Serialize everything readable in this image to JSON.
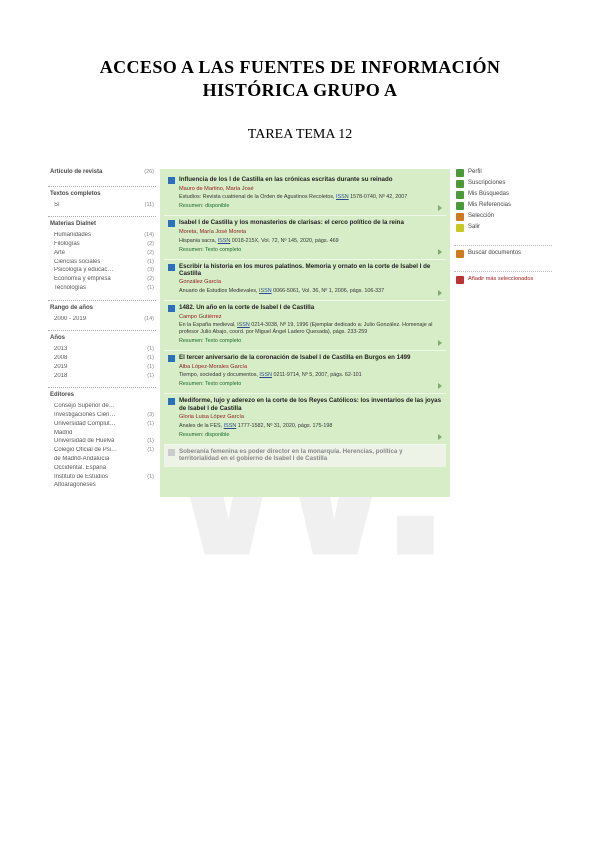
{
  "watermark": "W.",
  "title_line1": "ACCESO A LAS FUENTES DE INFORMACIÓN",
  "title_line2": "HISTÓRICA GRUPO A",
  "subtitle": "TAREA TEMA 12",
  "facets": {
    "block1": {
      "head": "Artículo de revista",
      "count": "(26)"
    },
    "block2": {
      "head": "Textos completos",
      "rows": [
        {
          "lbl": "Sí",
          "cnt": "(11)"
        }
      ]
    },
    "block3": {
      "head": "Materias Dialnet",
      "rows": [
        {
          "lbl": "Humanidades",
          "cnt": "(14)"
        },
        {
          "lbl": "Filologías",
          "cnt": "(2)"
        },
        {
          "lbl": "Arte",
          "cnt": "(2)"
        },
        {
          "lbl": "Ciencias sociales",
          "cnt": "(1)"
        },
        {
          "lbl": "Psicología y educac…",
          "cnt": "(3)"
        },
        {
          "lbl": "Economía y empresa",
          "cnt": "(2)"
        },
        {
          "lbl": "Tecnologías",
          "cnt": "(1)"
        }
      ]
    },
    "block4": {
      "head": "Rango de años",
      "rows": [
        {
          "lbl": "2000 - 2019",
          "cnt": "(14)"
        }
      ]
    },
    "block5": {
      "head": "Años",
      "rows": [
        {
          "lbl": "2013",
          "cnt": "(1)"
        },
        {
          "lbl": "2008",
          "cnt": "(1)"
        },
        {
          "lbl": "2019",
          "cnt": "(1)"
        },
        {
          "lbl": "2018",
          "cnt": "(1)"
        }
      ]
    },
    "block6": {
      "head": "Editores",
      "rows": [
        {
          "lbl": "Consejo Superior de…",
          "cnt": ""
        },
        {
          "lbl": "Investigaciones Cien…",
          "cnt": "(3)"
        },
        {
          "lbl": "Universidad Complut…",
          "cnt": "(1)"
        },
        {
          "lbl": "Madrid",
          "cnt": ""
        },
        {
          "lbl": "Universidad de Huelva",
          "cnt": "(1)"
        },
        {
          "lbl": "Colegio Oficial de Psi…",
          "cnt": "(1)"
        },
        {
          "lbl": "de Madrid-Andalucía",
          "cnt": ""
        },
        {
          "lbl": "Occidental. España",
          "cnt": ""
        },
        {
          "lbl": "Instituto de Estudios",
          "cnt": "(1)"
        },
        {
          "lbl": "Altoaragoneses",
          "cnt": ""
        }
      ]
    }
  },
  "records": [
    {
      "title": "Influencia de los I de Castilla en las crónicas escritas durante su reinado",
      "author": "Mauro de Martino, María José",
      "source_pre": "Estudios: Revista cuatrienal de la Orden de Agustinos Recoletos, ",
      "issn": "ISSN",
      "source_post": " 1578-0740, Nº 42, 2007",
      "summary": "Resumen: disponible"
    },
    {
      "title": "Isabel I de Castilla y los monasterios de clarisas: el cerco político de la reina",
      "author": "Moreta, María José Moreta",
      "source_pre": "Hispania sacra, ",
      "issn": "ISSN",
      "source_post": " 0018-215X, Vol. 72, Nº 145, 2020, págs. 469",
      "summary": "Resumen: Texto completo"
    },
    {
      "title": "Escribir la historia en los muros palatinos. Memoria y ornato en la corte de Isabel I de Castilla",
      "author": "González García",
      "source_pre": "Anuario de Estudios Medievales, ",
      "issn": "ISSN",
      "source_post": " 0066-5061, Vol. 36, Nº 1, 2006, págs. 106-337",
      "summary": ""
    },
    {
      "title": "1482. Un año en la corte de Isabel I de Castilla",
      "author": "Campo Gutiérrez",
      "source_pre": "En la España medieval, ",
      "issn": "ISSN",
      "source_post": " 0214-3038, Nº 19, 1996 (Ejemplar dedicado a: Julio González. Homenaje al profesor Julio Abajo, coord. por Miguel Ángel Ladero Quesada), págs. 233-259",
      "summary": "Resumen: Texto completo"
    },
    {
      "title": "El tercer aniversario de la coronación de Isabel I de Castilla en Burgos en 1499",
      "author": "Alba López-Morales García",
      "source_pre": "Tiempo, sociedad y documentos, ",
      "issn": "ISSN",
      "source_post": " 0211-9714, Nº 5, 2007, págs. 62-101",
      "summary": "Resumen: Texto completo"
    },
    {
      "title": "Mediforme, lujo y aderezo en la corte de los Reyes Católicos: los inventarios de las joyas de Isabel I de Castilla",
      "author": "Gloria Luisa López García",
      "source_pre": "Anales de la FES, ",
      "issn": "ISSN",
      "source_post": " 1777-1582, Nº 31, 2020, págs. 175-198",
      "summary": "Resumen: disponible"
    }
  ],
  "cut_record": {
    "title": "Soberanía femenina es poder director en la monarquía. Herencias, política y territorialidad en el gobierno de Isabel I de Castilla"
  },
  "rail": {
    "top": [
      {
        "color": "green",
        "lbl": "Perfil"
      },
      {
        "color": "green",
        "lbl": "Suscripciones"
      },
      {
        "color": "green",
        "lbl": "Mis Búsquedas"
      },
      {
        "color": "green",
        "lbl": "Mis Referencias"
      },
      {
        "color": "orange",
        "lbl": "Selección"
      },
      {
        "color": "yellow",
        "lbl": "Salir"
      }
    ],
    "mid": {
      "color": "orange",
      "lbl": "Buscar documentos"
    },
    "bottom": {
      "lbl": "Añadir más seleccionados"
    }
  }
}
